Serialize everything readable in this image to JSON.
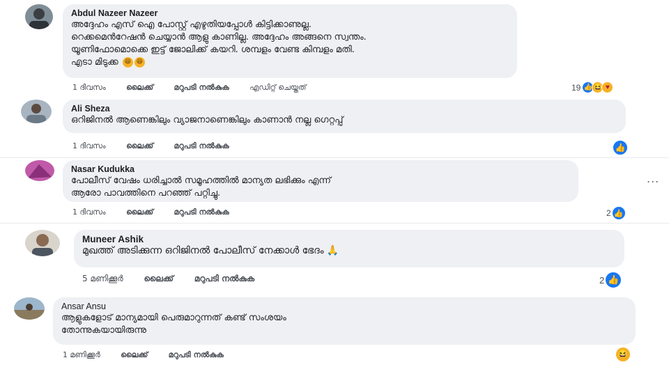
{
  "comments": [
    {
      "author": "Abdul Nazeer Nazeer",
      "text": "അദ്ദേഹം എസ് ഐ പോസ്റ്റ് എഴുതിയപ്പോൾ കിട്ടിക്കാണുല്ല.\nറെക്കമെൻറേഷൻ ചെയ്യാൻ ആളു കാണില്ല. അദ്ദേഹം അങ്ങനെ സ്വന്തം.\nയൂണിഫോമൊക്കെ ഇട്ട് ജോലിക്ക് കയറി. ശമ്പളം വേണ്ട കിമ്പളം മതി.\nഎടാ മിടുക്ക",
      "inline_emoji": [
        "laugh-emoji",
        "laugh-emoji"
      ],
      "time": "1 ദിവസം",
      "like": "ലൈക്ക്",
      "reply": "മറുപടി നൽകുക",
      "edited": "എഡിറ്റ് ചെയ്തത്",
      "reaction_count": "19",
      "reactions": [
        "like",
        "haha",
        "care"
      ]
    },
    {
      "author": "Ali Sheza",
      "text": "ഒറിജിനൽ ആണെങ്കിലും വ്യാജനാണെങ്കിലും കാണാൻ നല്ല ഗെറ്റപ്പ്",
      "time": "1 ദിവസം",
      "like": "ലൈക്ക്",
      "reply": "മറുപടി നൽകുക",
      "reaction_count": "",
      "reactions": [
        "like"
      ]
    },
    {
      "author": "Nasar Kudukka",
      "text": "പോലീസ് വേഷം ധരിച്ചാൽ സമൂഹത്തിൽ മാന്യത ലഭിക്കും എന്ന്\nആരോ പാവത്തിനെ പറഞ്ഞ് പറ്റിച്ചു.",
      "time": "1 ദിവസം",
      "like": "ലൈക്ക്",
      "reply": "മറുപടി നൽകുക",
      "reaction_count": "2",
      "reactions": [
        "like"
      ],
      "more": "..."
    },
    {
      "author": "Muneer Ashik",
      "text": "മുഖത്ത് അടിക്കുന്ന ഒറിജിനൽ പോലീസ് നേക്കാൾ ഭേദം",
      "inline_emoji": [
        "pray-emoji"
      ],
      "time": "5 മണിക്കൂർ",
      "like": "ലൈക്ക്",
      "reply": "മറുപടി നൽകുക",
      "reaction_count": "2",
      "reactions": [
        "like"
      ]
    },
    {
      "author": "Ansar Ansu",
      "text": "ആളുകളോട് മാന്യമായി പെരുമാറുന്നത് കണ്ട് സംശയം\nതോന്നുകയായിരുന്നു",
      "time": "1 മണിക്കൂർ",
      "like": "ലൈക്ക്",
      "reply": "മറുപടി നൽകുക",
      "reaction_count": "",
      "reactions": [
        "haha"
      ]
    }
  ],
  "colors": {
    "bubble": "#eef0f3",
    "like_blue": "#1877f2",
    "emoji_yellow": "#f7b125",
    "meta_text": "#4b4f56"
  }
}
